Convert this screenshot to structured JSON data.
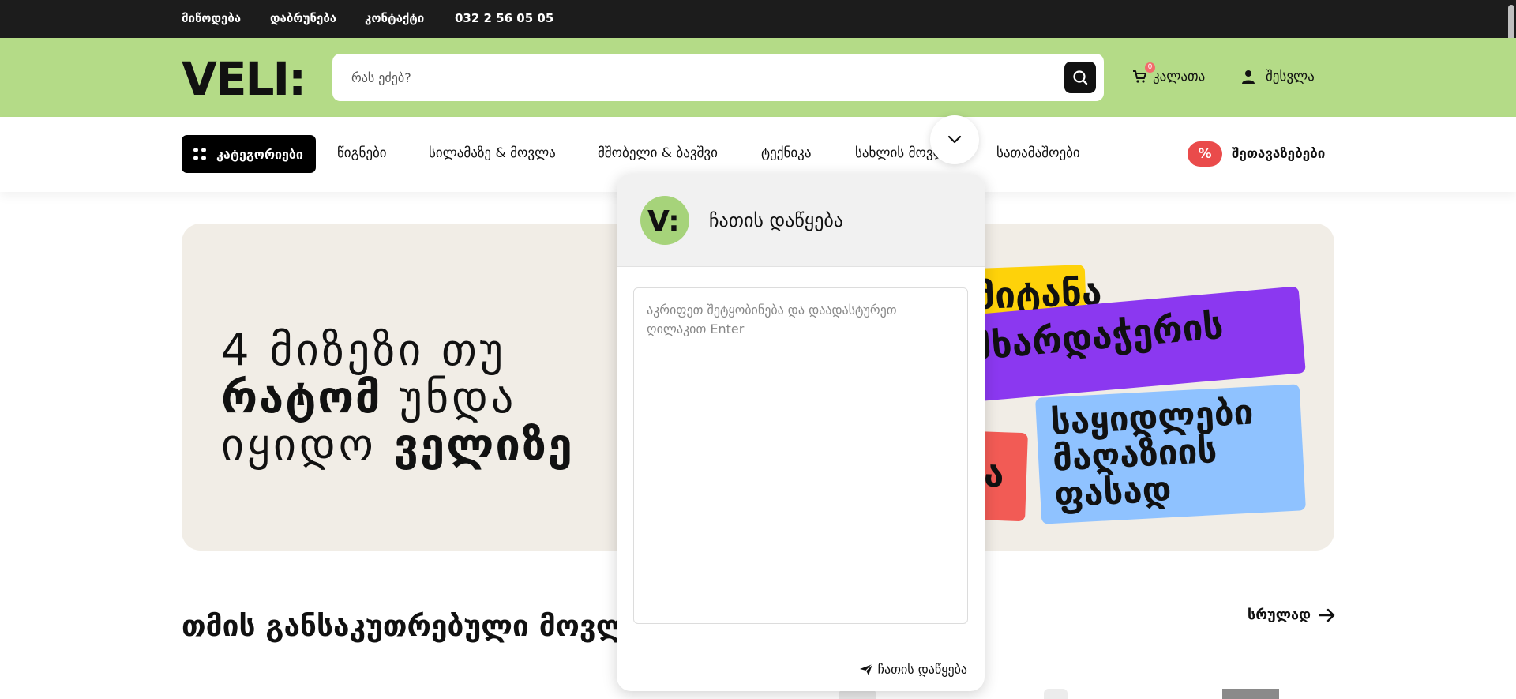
{
  "topbar": {
    "links": [
      "მიწოდება",
      "დაბრუნება",
      "კონტაქტი",
      "032 2 56 05 05"
    ]
  },
  "header": {
    "logo_text": "VELI:",
    "search_placeholder": "რას ეძებ?",
    "cart_label": "კალათა",
    "cart_count": "0",
    "login_label": "შესვლა"
  },
  "nav": {
    "categories_label": "კატეგორიები",
    "items": [
      "წიგნები",
      "სილამაზე & მოვლა",
      "მშობელი & ბავშვი",
      "ტექნიკა",
      "სახლის მოვლა",
      "სათამაშოები"
    ],
    "offers_icon_text": "%",
    "offers_label": "შეთავაზებები"
  },
  "hero": {
    "line1": "4 მიზეზი თუ",
    "line2_bold": "რატომ",
    "line2_thin": "უნდა",
    "line3_thin": "იყიდო",
    "line3_bold": "ველიზე",
    "sticker_yellow": "მიტანა",
    "sticker_purple": "მხარდაჭერის",
    "sticker_red": "ბა",
    "sticker_blue_1": "საყიდლები",
    "sticker_blue_2": "მაღაზიის",
    "sticker_blue_3": "ფასად"
  },
  "section": {
    "title": "თმის განსაკუთრებული მოვლა",
    "see_all": "სრულად"
  },
  "chat": {
    "title": "ჩათის დაწყება",
    "avatar_text": "V:",
    "placeholder": "აკრიფეთ შეტყობინება და დაადასტურეთ ღილაკით Enter",
    "send_label": "ჩათის დაწყება"
  },
  "colors": {
    "header_bg": "#b4db87",
    "topbar_bg": "#1c1c1c",
    "hero_bg": "#f1ede6",
    "offers_red": "#ea4b4b",
    "sticker_yellow": "#fed20a",
    "sticker_purple": "#8b38f0",
    "sticker_red": "#f25b55",
    "sticker_blue": "#8fc2ff"
  }
}
